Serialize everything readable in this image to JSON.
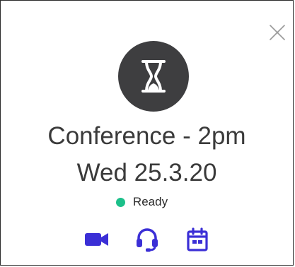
{
  "card": {
    "title_line1": "Conference - 2pm",
    "title_line2": "Wed 25.3.20",
    "status": {
      "label": "Ready",
      "color": "#1cc08a"
    },
    "avatar": {
      "icon": "hourglass-icon",
      "background": "#3e3e40"
    },
    "close_icon": "close-icon",
    "actions": [
      {
        "icon": "video-camera-icon",
        "color": "#3b2fd6"
      },
      {
        "icon": "headset-icon",
        "color": "#3b2fd6"
      },
      {
        "icon": "calendar-icon",
        "color": "#3b2fd6"
      }
    ]
  }
}
